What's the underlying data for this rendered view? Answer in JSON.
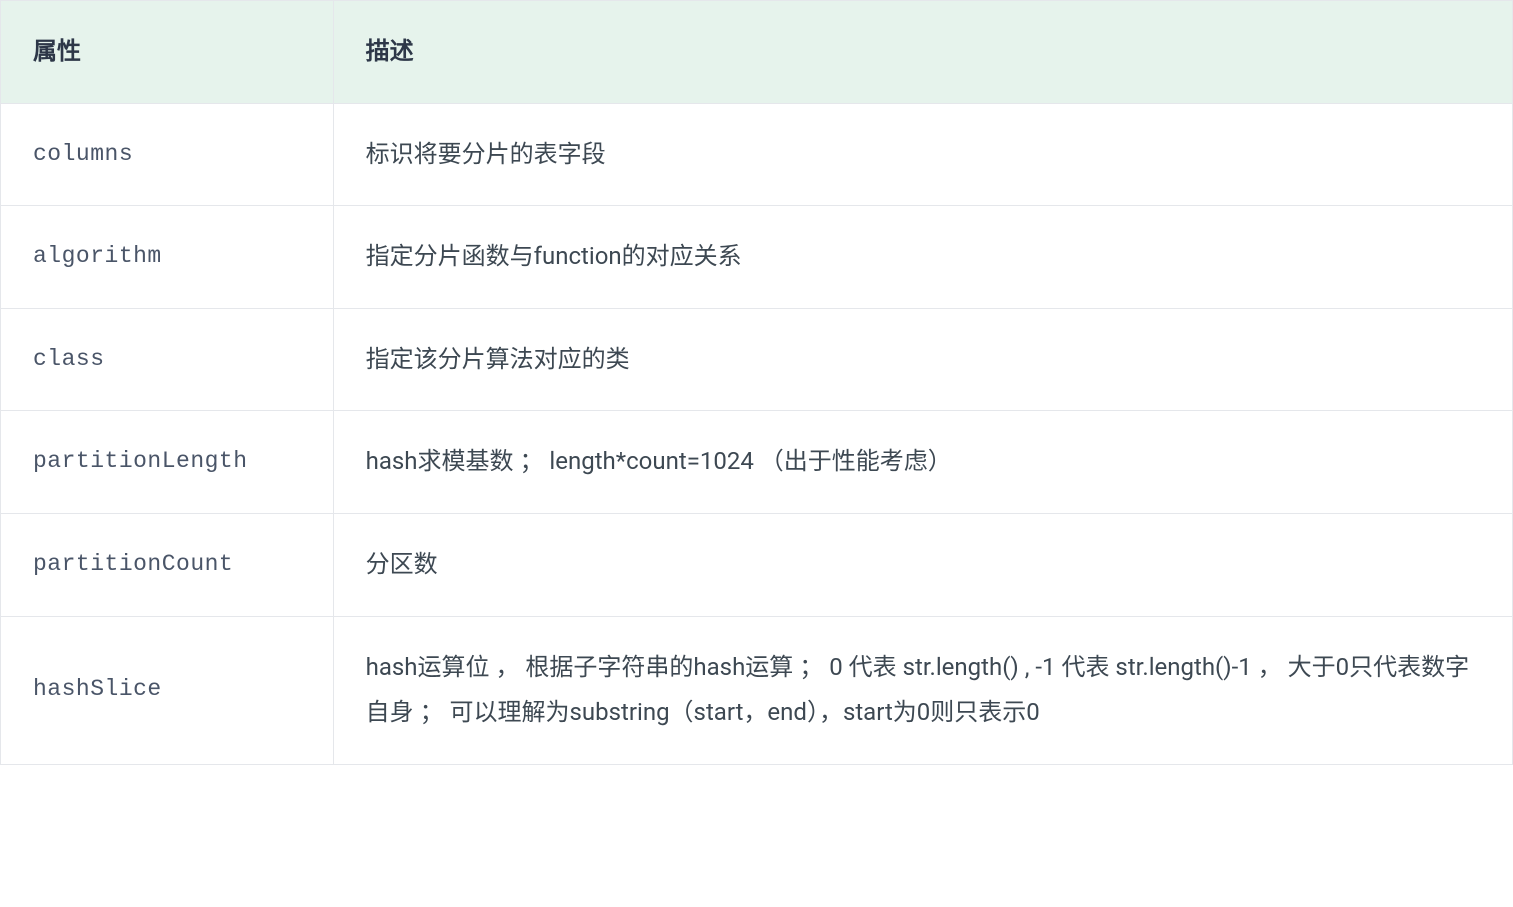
{
  "table": {
    "headers": {
      "attribute": "属性",
      "description": "描述"
    },
    "rows": [
      {
        "attribute": "columns",
        "description": "标识将要分片的表字段"
      },
      {
        "attribute": "algorithm",
        "description": "指定分片函数与function的对应关系"
      },
      {
        "attribute": "class",
        "description": "指定该分片算法对应的类"
      },
      {
        "attribute": "partitionLength",
        "description": "hash求模基数 ； length*count=1024 （出于性能考虑）"
      },
      {
        "attribute": "partitionCount",
        "description": "分区数"
      },
      {
        "attribute": "hashSlice",
        "description": "hash运算位 ， 根据子字符串的hash运算 ； 0 代表 str.length() , -1 代表 str.length()-1 ， 大于0只代表数字自身 ； 可以理解为substring（start，end），start为0则只表示0"
      }
    ]
  }
}
